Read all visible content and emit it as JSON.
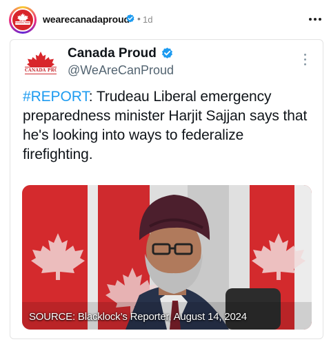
{
  "post": {
    "username": "wearecanadaproud",
    "separator": "•",
    "time": "1d",
    "avatar_text": "CANADA PROUD"
  },
  "tweet": {
    "display_name": "Canada Proud",
    "handle": "@WeAreCanProud",
    "logo_text": "CANADA PROUD",
    "hashtag": "#REPORT",
    "text": ": Trudeau Liberal emergency preparedness minister Harjit Sajjan says that he's looking into ways to federalize firefighting.",
    "media_caption": "SOURCE: Blacklock’s Reporter, August 14, 2024"
  },
  "icons": {
    "verified": "verified-badge-icon",
    "more_horizontal": "more-horizontal-icon",
    "more_vertical": "more-vertical-icon"
  },
  "colors": {
    "verified_blue": "#1d9bf0",
    "hashtag_blue": "#1d9bf0",
    "canada_red": "#d8262b"
  }
}
